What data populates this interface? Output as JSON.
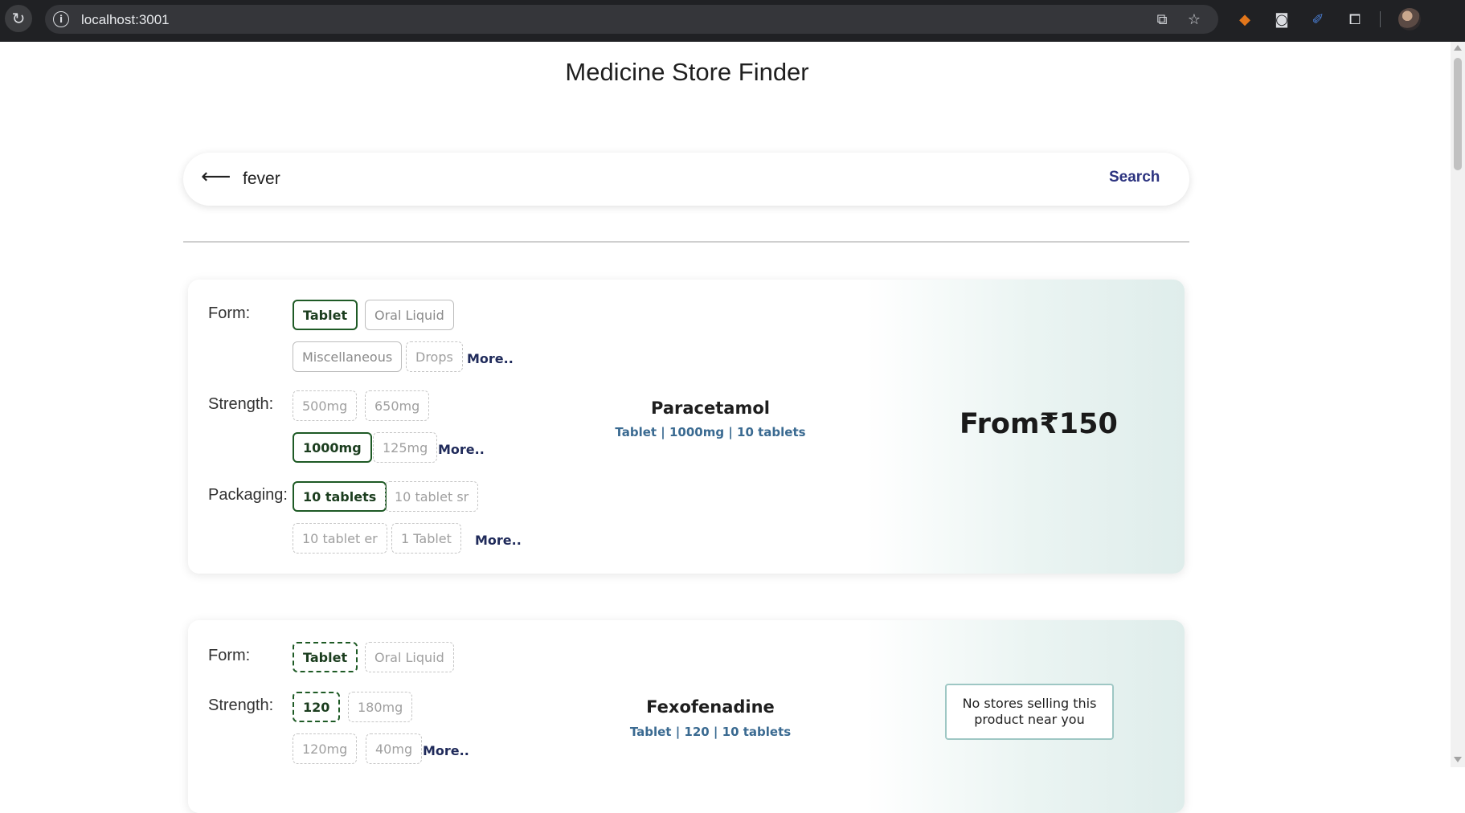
{
  "browser": {
    "url": "localhost:3001"
  },
  "page": {
    "title": "Medicine Store Finder"
  },
  "search": {
    "value": "fever",
    "button_label": "Search"
  },
  "labels": {
    "form": "Form:",
    "strength": "Strength:",
    "packaging": "Packaging:",
    "more": "More.."
  },
  "products": [
    {
      "name": "Paracetamol",
      "meta": "Tablet | 1000mg | 10 tablets",
      "price": "From₹150",
      "forms": [
        {
          "label": "Tablet",
          "state": "selected"
        },
        {
          "label": "Oral Liquid",
          "state": "available"
        },
        {
          "label": "Miscellaneous",
          "state": "available"
        },
        {
          "label": "Drops",
          "state": "unavailable"
        }
      ],
      "strengths": [
        {
          "label": "500mg",
          "state": "unavailable"
        },
        {
          "label": "650mg",
          "state": "unavailable"
        },
        {
          "label": "1000mg",
          "state": "selected"
        },
        {
          "label": "125mg",
          "state": "unavailable"
        }
      ],
      "packaging": [
        {
          "label": "10 tablets",
          "state": "selected"
        },
        {
          "label": "10 tablet sr",
          "state": "unavailable"
        },
        {
          "label": "10 tablet er",
          "state": "unavailable"
        },
        {
          "label": "1 Tablet",
          "state": "unavailable"
        }
      ]
    },
    {
      "name": "Fexofenadine",
      "meta": "Tablet | 120 | 10 tablets",
      "status": "No stores selling this product near you",
      "forms": [
        {
          "label": "Tablet",
          "state": "selected-dashed"
        },
        {
          "label": "Oral Liquid",
          "state": "unavailable"
        }
      ],
      "strengths": [
        {
          "label": "120",
          "state": "selected-dashed"
        },
        {
          "label": "180mg",
          "state": "unavailable"
        },
        {
          "label": "120mg",
          "state": "unavailable"
        },
        {
          "label": "40mg",
          "state": "unavailable"
        }
      ]
    }
  ],
  "colors": {
    "selected_border": "#1e5a25",
    "link": "#2d3480",
    "meta": "#3a6a91",
    "card_gradient_end": "#dfedeb"
  }
}
